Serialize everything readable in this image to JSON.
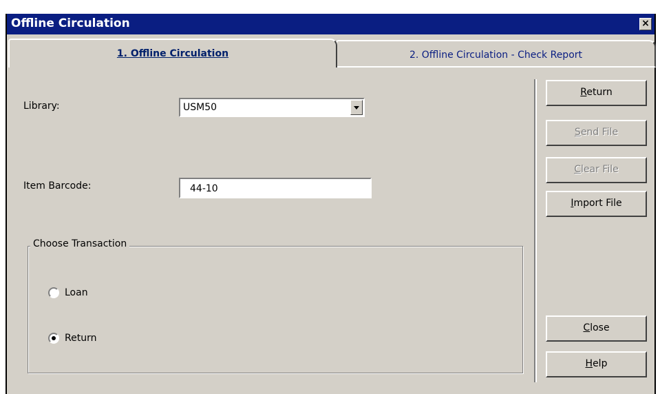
{
  "window": {
    "title": "Offline Circulation"
  },
  "tabs": [
    {
      "label": "1. Offline Circulation"
    },
    {
      "label": "2. Offline Circulation - Check Report"
    }
  ],
  "form": {
    "library_label": "Library:",
    "library_value": "USM50",
    "barcode_label": "Item Barcode:",
    "barcode_value": "44-10",
    "transaction_group": "Choose Transaction",
    "options": [
      {
        "label": "Loan",
        "selected": false
      },
      {
        "label": "Return",
        "selected": true
      }
    ]
  },
  "buttons": {
    "return": {
      "underline": "R",
      "rest": "eturn"
    },
    "send_file": {
      "underline": "S",
      "rest": "end File"
    },
    "clear_file": {
      "underline": "C",
      "rest": "lear File"
    },
    "import_file": {
      "underline": "I",
      "rest": "mport File"
    },
    "close": {
      "underline": "C",
      "rest": "lose"
    },
    "help": {
      "underline": "H",
      "rest": "elp"
    }
  }
}
